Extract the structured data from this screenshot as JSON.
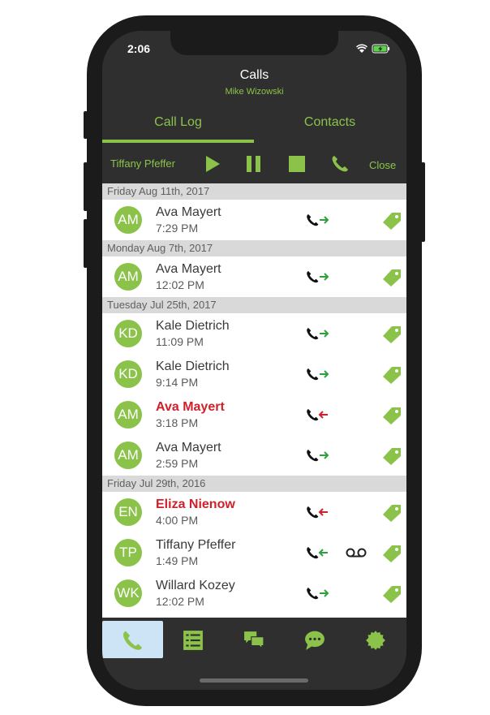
{
  "status": {
    "time": "2:06"
  },
  "header": {
    "title": "Calls",
    "subtitle": "Mike Wizowski"
  },
  "tabs": [
    {
      "label": "Call Log"
    },
    {
      "label": "Contacts"
    }
  ],
  "player": {
    "name": "Tiffany Pfeffer",
    "close_label": "Close"
  },
  "sections": [
    {
      "date": "Friday Aug 11th, 2017",
      "calls": [
        {
          "initials": "AM",
          "name": "Ava Mayert",
          "time": "7:29 PM",
          "direction": "outgoing",
          "missed": false,
          "voicemail": false
        }
      ]
    },
    {
      "date": "Monday Aug 7th, 2017",
      "calls": [
        {
          "initials": "AM",
          "name": "Ava Mayert",
          "time": "12:02 PM",
          "direction": "outgoing",
          "missed": false,
          "voicemail": false
        }
      ]
    },
    {
      "date": "Tuesday Jul 25th, 2017",
      "calls": [
        {
          "initials": "KD",
          "name": "Kale Dietrich",
          "time": "11:09 PM",
          "direction": "outgoing",
          "missed": false,
          "voicemail": false
        },
        {
          "initials": "KD",
          "name": "Kale Dietrich",
          "time": "9:14 PM",
          "direction": "outgoing",
          "missed": false,
          "voicemail": false
        },
        {
          "initials": "AM",
          "name": "Ava Mayert",
          "time": "3:18 PM",
          "direction": "incoming",
          "missed": true,
          "voicemail": false
        },
        {
          "initials": "AM",
          "name": "Ava Mayert",
          "time": "2:59 PM",
          "direction": "outgoing",
          "missed": false,
          "voicemail": false
        }
      ]
    },
    {
      "date": "Friday Jul 29th, 2016",
      "calls": [
        {
          "initials": "EN",
          "name": "Eliza Nienow",
          "time": "4:00 PM",
          "direction": "incoming",
          "missed": true,
          "voicemail": false
        },
        {
          "initials": "TP",
          "name": "Tiffany Pfeffer",
          "time": "1:49 PM",
          "direction": "incoming-answered",
          "missed": false,
          "voicemail": true
        },
        {
          "initials": "WK",
          "name": "Willard Kozey",
          "time": "12:02 PM",
          "direction": "outgoing",
          "missed": false,
          "voicemail": false
        }
      ]
    }
  ],
  "tabbar": [
    {
      "icon": "phone-icon",
      "active": true
    },
    {
      "icon": "list-icon",
      "active": false
    },
    {
      "icon": "chat-bubbles-icon",
      "active": false
    },
    {
      "icon": "speech-bubble-icon",
      "active": false
    },
    {
      "icon": "settings-badge-icon",
      "active": false
    }
  ],
  "colors": {
    "accent": "#8bc34a",
    "missed": "#d0212b",
    "outgoing_arrow": "#2e9e3f",
    "incoming_arrow": "#d0212b",
    "active_tab_bg": "#cde3f6"
  }
}
